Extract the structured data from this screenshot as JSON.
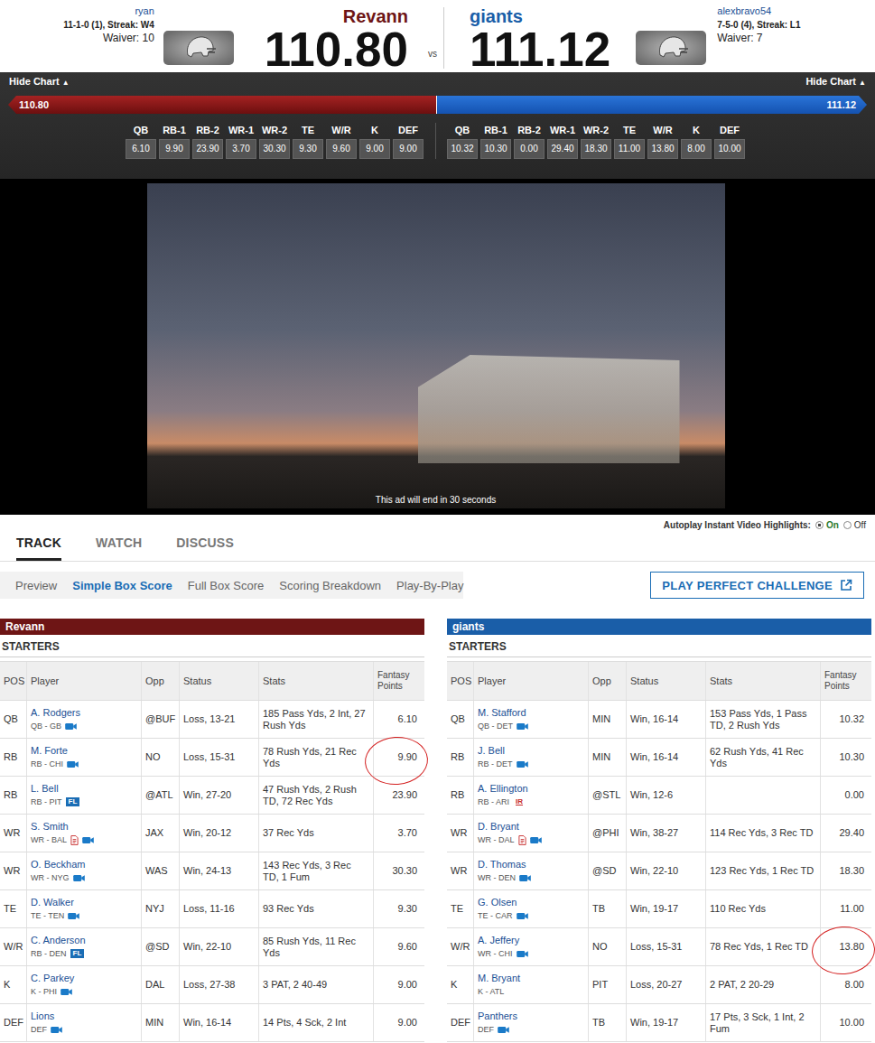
{
  "header": {
    "home": {
      "owner": "ryan",
      "record": "11-1-0 (1), Streak: W4",
      "waiver": "Waiver: 10",
      "team": "Revann",
      "score": "110.80"
    },
    "vs": "vs",
    "away": {
      "owner": "alexbravo54",
      "record": "7-5-0 (4), Streak: L1",
      "waiver": "Waiver: 7",
      "team": "giants",
      "score": "111.12"
    }
  },
  "chart": {
    "toggles": [
      {
        "label": "Hide Chart",
        "icon": "▲"
      },
      {
        "label": "Hide Chart",
        "icon": "▲"
      }
    ],
    "bar": {
      "home_label": "110.80",
      "away_label": "111.12",
      "level": 0.4993
    },
    "columns": [
      "QB",
      "RB-1",
      "RB-2",
      "WR-1",
      "WR-2",
      "TE",
      "W/R",
      "K",
      "DEF"
    ],
    "home_values": [
      "6.10",
      "9.90",
      "23.90",
      "3.70",
      "30.30",
      "9.30",
      "9.60",
      "9.00",
      "9.00"
    ],
    "away_values": [
      "10.32",
      "10.30",
      "0.00",
      "29.40",
      "18.30",
      "11.00",
      "13.80",
      "8.00",
      "10.00"
    ]
  },
  "ad": {
    "caption": "This ad will end in 30 seconds"
  },
  "autoplay": {
    "label": "Autoplay Instant Video Highlights:",
    "options": [
      {
        "label": "On",
        "selected": true
      },
      {
        "label": "Off",
        "selected": false
      }
    ]
  },
  "tabs": [
    {
      "label": "TRACK",
      "selected": true
    },
    {
      "label": "WATCH",
      "selected": false
    },
    {
      "label": "DISCUSS",
      "selected": false
    }
  ],
  "subtabs": [
    {
      "label": "Preview",
      "selected": false
    },
    {
      "label": "Simple Box Score",
      "selected": true
    },
    {
      "label": "Full Box Score",
      "selected": false
    },
    {
      "label": "Scoring Breakdown",
      "selected": false
    },
    {
      "label": "Play-By-Play",
      "selected": false
    }
  ],
  "challenge_button": {
    "label": "PLAY PERFECT CHALLENGE"
  },
  "teams": [
    {
      "name": "Revann",
      "color": "#6e1515",
      "section": "STARTERS",
      "columns": [
        "POS",
        "Player",
        "Opp",
        "Status",
        "Stats",
        "Fantasy Points"
      ],
      "rows": [
        {
          "pos": "QB",
          "name": "A. Rodgers",
          "team_pos": "QB - GB",
          "note": false,
          "video": true,
          "badge": null,
          "opp": "@BUF",
          "status": "Loss, 13-21",
          "stats": "185 Pass Yds, 2 Int, 27 Rush Yds",
          "points": "6.10",
          "circled": false
        },
        {
          "pos": "RB",
          "name": "M. Forte",
          "team_pos": "RB - CHI",
          "note": false,
          "video": true,
          "badge": null,
          "opp": "NO",
          "status": "Loss, 15-31",
          "stats": "78 Rush Yds, 21 Rec Yds",
          "points": "9.90",
          "circled": true
        },
        {
          "pos": "RB",
          "name": "L. Bell",
          "team_pos": "RB - PIT",
          "note": false,
          "video": false,
          "badge": {
            "label": "FL",
            "kind": "fl"
          },
          "opp": "@ATL",
          "status": "Win, 27-20",
          "stats": "47 Rush Yds, 2 Rush TD, 72 Rec Yds",
          "points": "23.90",
          "circled": false
        },
        {
          "pos": "WR",
          "name": "S. Smith",
          "team_pos": "WR - BAL",
          "note": true,
          "video": true,
          "badge": null,
          "opp": "JAX",
          "status": "Win, 20-12",
          "stats": "37 Rec Yds",
          "points": "3.70",
          "circled": false
        },
        {
          "pos": "WR",
          "name": "O. Beckham",
          "team_pos": "WR - NYG",
          "note": false,
          "video": true,
          "badge": null,
          "opp": "WAS",
          "status": "Win, 24-13",
          "stats": "143 Rec Yds, 3 Rec TD, 1 Fum",
          "points": "30.30",
          "circled": false
        },
        {
          "pos": "TE",
          "name": "D. Walker",
          "team_pos": "TE - TEN",
          "note": false,
          "video": true,
          "badge": null,
          "opp": "NYJ",
          "status": "Loss, 11-16",
          "stats": "93 Rec Yds",
          "points": "9.30",
          "circled": false
        },
        {
          "pos": "W/R",
          "name": "C. Anderson",
          "team_pos": "RB - DEN",
          "note": false,
          "video": false,
          "badge": {
            "label": "FL",
            "kind": "fl"
          },
          "opp": "@SD",
          "status": "Win, 22-10",
          "stats": "85 Rush Yds, 11 Rec Yds",
          "points": "9.60",
          "circled": false
        },
        {
          "pos": "K",
          "name": "C. Parkey",
          "team_pos": "K - PHI",
          "note": false,
          "video": true,
          "badge": null,
          "opp": "DAL",
          "status": "Loss, 27-38",
          "stats": "3 PAT, 2 40-49",
          "points": "9.00",
          "circled": false
        },
        {
          "pos": "DEF",
          "name": "Lions",
          "team_pos": "DEF",
          "note": false,
          "video": true,
          "badge": null,
          "opp": "MIN",
          "status": "Win, 16-14",
          "stats": "14 Pts, 4 Sck, 2 Int",
          "points": "9.00",
          "circled": false
        }
      ]
    },
    {
      "name": "giants",
      "color": "#1a5ea8",
      "section": "STARTERS",
      "columns": [
        "POS",
        "Player",
        "Opp",
        "Status",
        "Stats",
        "Fantasy Points"
      ],
      "rows": [
        {
          "pos": "QB",
          "name": "M. Stafford",
          "team_pos": "QB - DET",
          "note": false,
          "video": true,
          "badge": null,
          "opp": "MIN",
          "status": "Win, 16-14",
          "stats": "153 Pass Yds, 1 Pass TD, 2 Rush Yds",
          "points": "10.32",
          "circled": false
        },
        {
          "pos": "RB",
          "name": "J. Bell",
          "team_pos": "RB - DET",
          "note": false,
          "video": true,
          "badge": null,
          "opp": "MIN",
          "status": "Win, 16-14",
          "stats": "62 Rush Yds, 41 Rec Yds",
          "points": "10.30",
          "circled": false
        },
        {
          "pos": "RB",
          "name": "A. Ellington",
          "team_pos": "RB - ARI",
          "note": false,
          "video": false,
          "badge": {
            "label": "IR",
            "kind": "ir"
          },
          "opp": "@STL",
          "status": "Win, 12-6",
          "stats": "",
          "points": "0.00",
          "circled": false
        },
        {
          "pos": "WR",
          "name": "D. Bryant",
          "team_pos": "WR - DAL",
          "note": true,
          "video": true,
          "badge": null,
          "opp": "@PHI",
          "status": "Win, 38-27",
          "stats": "114 Rec Yds, 3 Rec TD",
          "points": "29.40",
          "circled": false
        },
        {
          "pos": "WR",
          "name": "D. Thomas",
          "team_pos": "WR - DEN",
          "note": false,
          "video": true,
          "badge": null,
          "opp": "@SD",
          "status": "Win, 22-10",
          "stats": "123 Rec Yds, 1 Rec TD",
          "points": "18.30",
          "circled": false
        },
        {
          "pos": "TE",
          "name": "G. Olsen",
          "team_pos": "TE - CAR",
          "note": false,
          "video": true,
          "badge": null,
          "opp": "TB",
          "status": "Win, 19-17",
          "stats": "110 Rec Yds",
          "points": "11.00",
          "circled": false
        },
        {
          "pos": "W/R",
          "name": "A. Jeffery",
          "team_pos": "WR - CHI",
          "note": false,
          "video": true,
          "badge": null,
          "opp": "NO",
          "status": "Loss, 15-31",
          "stats": "78 Rec Yds, 1 Rec TD",
          "points": "13.80",
          "circled": true
        },
        {
          "pos": "K",
          "name": "M. Bryant",
          "team_pos": "K - ATL",
          "note": false,
          "video": false,
          "badge": null,
          "opp": "PIT",
          "status": "Loss, 20-27",
          "stats": "2 PAT, 2 20-29",
          "points": "8.00",
          "circled": false
        },
        {
          "pos": "DEF",
          "name": "Panthers",
          "team_pos": "DEF",
          "note": false,
          "video": true,
          "badge": null,
          "opp": "TB",
          "status": "Win, 19-17",
          "stats": "17 Pts, 3 Sck, 1 Int, 2 Fum",
          "points": "10.00",
          "circled": false
        }
      ]
    }
  ]
}
